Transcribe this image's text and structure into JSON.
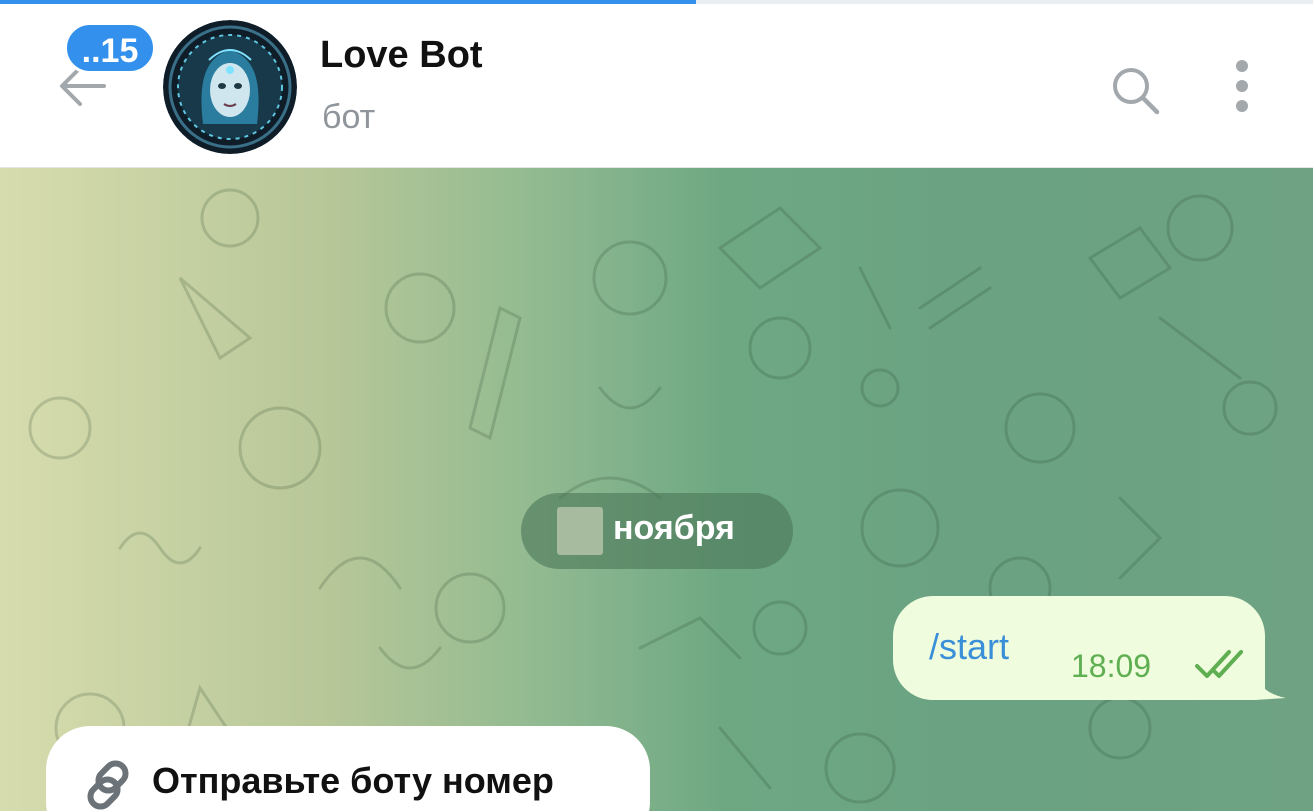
{
  "progress": {
    "fraction": 0.53,
    "color": "#3390ec"
  },
  "header": {
    "back_icon": "arrow-left-icon",
    "unread_count": "..15",
    "title": "Love Bot",
    "subtitle": "бот",
    "search_icon": "search-icon",
    "more_icon": "more-vertical-icon"
  },
  "chat": {
    "date_label": "ноября",
    "messages": [
      {
        "direction": "out",
        "text": "/start",
        "time": "18:09",
        "status": "read"
      },
      {
        "direction": "in",
        "icon": "link-icon",
        "text": "Отправьте боту номер"
      }
    ]
  },
  "colors": {
    "accent": "#3390ec",
    "outgoing_bubble": "#effdde",
    "incoming_bubble": "#ffffff",
    "time_green": "#5fae52"
  }
}
